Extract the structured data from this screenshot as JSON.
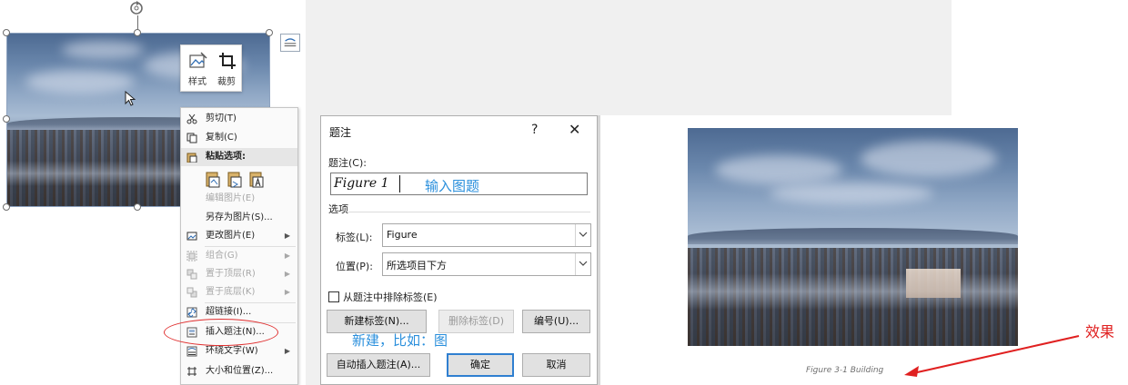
{
  "mini_toolbar": {
    "style_label": "样式",
    "crop_label": "裁剪"
  },
  "context_menu": {
    "items": [
      {
        "label": "剪切(T)",
        "icon": "scissors-icon",
        "enabled": true
      },
      {
        "label": "复制(C)",
        "icon": "copy-icon",
        "enabled": true
      },
      {
        "label": "粘贴选项:",
        "icon": "paste-icon",
        "enabled": true
      },
      {
        "label": "编辑图片(E)",
        "icon": "",
        "enabled": false
      },
      {
        "label": "另存为图片(S)...",
        "icon": "",
        "enabled": true
      },
      {
        "label": "更改图片(E)",
        "icon": "change-picture-icon",
        "enabled": true,
        "submenu": true
      },
      {
        "label": "组合(G)",
        "icon": "group-icon",
        "enabled": false,
        "submenu": true
      },
      {
        "label": "置于顶层(R)",
        "icon": "bring-front-icon",
        "enabled": false,
        "submenu": true
      },
      {
        "label": "置于底层(K)",
        "icon": "send-back-icon",
        "enabled": false,
        "submenu": true
      },
      {
        "label": "超链接(I)...",
        "icon": "link-icon",
        "enabled": true
      },
      {
        "label": "插入题注(N)...",
        "icon": "insert-caption-icon",
        "enabled": true
      },
      {
        "label": "环绕文字(W)",
        "icon": "wrap-text-icon",
        "enabled": true,
        "submenu": true
      },
      {
        "label": "大小和位置(Z)...",
        "icon": "size-position-icon",
        "enabled": true
      }
    ]
  },
  "dialog": {
    "title": "题注",
    "help": "?",
    "close": "✕",
    "caption_label": "题注(C):",
    "caption_value": "Figure 1",
    "caption_hint": "输入图题",
    "options_label": "选项",
    "label_label": "标签(L):",
    "label_value": "Figure",
    "position_label": "位置(P):",
    "position_value": "所选项目下方",
    "exclude_label": "从题注中排除标签(E)",
    "exclude_checked": false,
    "new_label_button": "新建标签(N)...",
    "delete_label_button": "删除标签(D)",
    "numbering_button": "编号(U)...",
    "auto_caption_button": "自动插入题注(A)...",
    "ok_button": "确定",
    "cancel_button": "取消",
    "new_hint": "新建，比如：图"
  },
  "effect": {
    "caption": "Figure 3-1 Building",
    "label": "效果"
  },
  "colors": {
    "annotation_blue": "#2a8fdc",
    "annotation_red": "#e02020"
  }
}
